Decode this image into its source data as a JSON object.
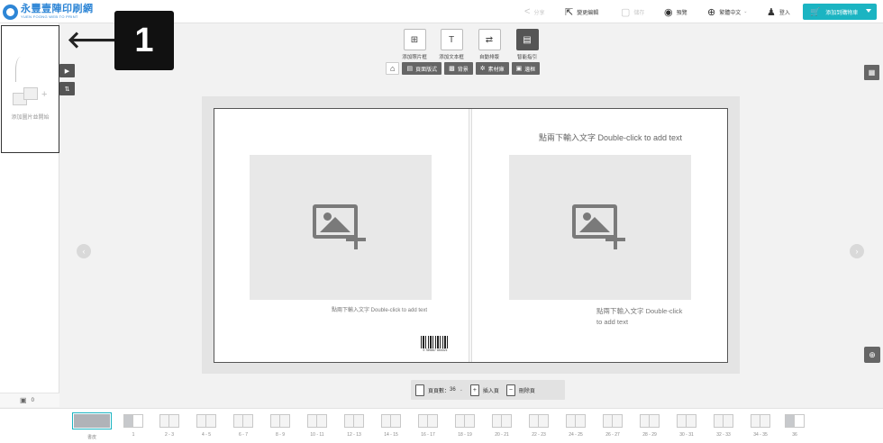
{
  "brand": {
    "logo_main": "永豐壹陣印刷網",
    "logo_sub": "YUEN FOONG WEB TO PRINT"
  },
  "header": {
    "share": "分享",
    "edit": "變更編輯",
    "save": "儲存",
    "preview": "預覽",
    "language": "繁體中文",
    "login": "登入",
    "cart": "添加到購物車"
  },
  "left_panel": {
    "add_photo_label": "+",
    "hint": "添加圖片並開始",
    "count": "0"
  },
  "callout": {
    "number": "1",
    "arrow": "🡐"
  },
  "tools": [
    {
      "label": "添加照片框",
      "icon": "⊞"
    },
    {
      "label": "添加文本框",
      "icon": "T"
    },
    {
      "label": "自動排版",
      "icon": "⇄"
    },
    {
      "label": "智能指引",
      "icon": "▤"
    }
  ],
  "tabs": {
    "home_icon": "⌂",
    "layout": "頁面版式",
    "background": "背景",
    "materials": "素材庫",
    "frame": "邊框"
  },
  "canvas": {
    "right_title": "點兩下輸入文字 Double-click to add text",
    "left_caption": "點兩下輸入文字 Double-click to add text",
    "right_caption_line1": "點兩下輸入文字 Double-click",
    "right_caption_line2": "to add text",
    "barcode_number": "9 789867 654321"
  },
  "page_controls": {
    "page_count_label": "頁頁數：",
    "page_count_value": "36",
    "insert_label": "插入頁",
    "delete_label": "刪除頁"
  },
  "thumbnails": [
    "書皮",
    "1",
    "2 - 3",
    "4 - 5",
    "6 - 7",
    "8 - 9",
    "10 - 11",
    "12 - 13",
    "14 - 15",
    "16 - 17",
    "18 - 19",
    "20 - 21",
    "22 - 23",
    "24 - 25",
    "26 - 27",
    "28 - 29",
    "30 - 31",
    "32 - 33",
    "34 - 35",
    "36"
  ],
  "colors": {
    "accent": "#1bb4c2",
    "primary_blue": "#1f70d9"
  }
}
